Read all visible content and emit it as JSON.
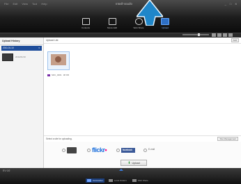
{
  "app": {
    "title": "Intelli-studio"
  },
  "menu": [
    "File",
    "Edit",
    "View",
    "Tool",
    "Help"
  ],
  "window_controls": [
    "_",
    "□",
    "X"
  ],
  "modes": [
    {
      "label": "Contents",
      "icon": "folder-icon"
    },
    {
      "label": "Movie Edit",
      "icon": "film-edit-icon"
    },
    {
      "label": "Web Share",
      "icon": "web-share-icon"
    },
    {
      "label": "Upload",
      "icon": "upload-icon",
      "active": true
    }
  ],
  "sidebar": {
    "header": "Upload History",
    "date": "2011.01.10",
    "item_meta": "2011/01/10"
  },
  "main": {
    "header": "Upload List",
    "header_button": "Add",
    "file_name": "SDC_0001",
    "file_size": "38 KB"
  },
  "select_bar": {
    "label": "Select a site for uploading.",
    "button": "Site Management"
  },
  "sites": {
    "flickr_blue": "flickr",
    "flickr_pink": "•",
    "facebook": "facebook",
    "email": "E-mail"
  },
  "upload_button": "Upload",
  "bottom": {
    "info": "EV 0/2",
    "tabs": [
      {
        "label": "Camcorder",
        "icon": "camcorder-icon",
        "active": true
      },
      {
        "label": "Local Folders",
        "icon": "folder-icon"
      },
      {
        "label": "Web Share",
        "icon": "web-icon"
      }
    ]
  },
  "colors": {
    "accent": "#2d6fc5",
    "arrow": "#1f86c9"
  }
}
